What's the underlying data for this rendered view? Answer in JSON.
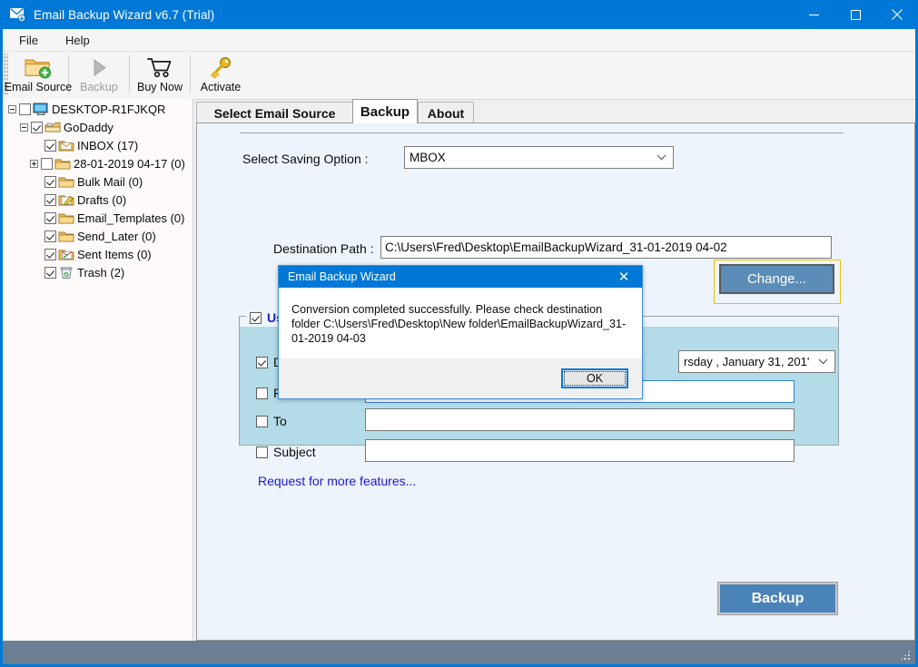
{
  "window": {
    "title": "Email Backup Wizard v6.7 (Trial)",
    "title_icon": "envelope-download-icon",
    "minimize_label": "—",
    "maximize_label": "□",
    "close_label": "✕",
    "accent_color": "#0078d7"
  },
  "menubar": {
    "items": [
      {
        "label": "File"
      },
      {
        "label": "Help"
      }
    ]
  },
  "toolbar": {
    "buttons": [
      {
        "label": "Email Source",
        "icon": "folder-add-icon",
        "disabled": false
      },
      {
        "label": "Backup",
        "icon": "play-triangle-icon",
        "disabled": true
      },
      {
        "label": "Buy Now",
        "icon": "shopping-cart-icon",
        "disabled": false
      },
      {
        "label": "Activate",
        "icon": "key-icon",
        "disabled": false
      }
    ]
  },
  "tree": {
    "nodes": [
      {
        "label": "DESKTOP-R1FJKQR",
        "depth": 0,
        "expander": "minus",
        "checked": false,
        "icon": "computer-icon"
      },
      {
        "label": "GoDaddy",
        "depth": 1,
        "expander": "minus",
        "checked": true,
        "icon": "mailbox-icon"
      },
      {
        "label": "INBOX (17)",
        "depth": 2,
        "expander": "none",
        "checked": true,
        "icon": "inbox-folder-icon"
      },
      {
        "label": "28-01-2019 04-17 (0)",
        "depth": 2,
        "expander": "plus",
        "checked": false,
        "icon": "folder-icon"
      },
      {
        "label": "Bulk Mail (0)",
        "depth": 2,
        "expander": "none",
        "checked": true,
        "icon": "folder-icon"
      },
      {
        "label": "Drafts (0)",
        "depth": 2,
        "expander": "none",
        "checked": true,
        "icon": "drafts-folder-icon"
      },
      {
        "label": "Email_Templates (0)",
        "depth": 2,
        "expander": "none",
        "checked": true,
        "icon": "folder-icon"
      },
      {
        "label": "Send_Later (0)",
        "depth": 2,
        "expander": "none",
        "checked": true,
        "icon": "folder-icon"
      },
      {
        "label": "Sent Items (0)",
        "depth": 2,
        "expander": "none",
        "checked": true,
        "icon": "sent-folder-icon"
      },
      {
        "label": "Trash (2)",
        "depth": 2,
        "expander": "none",
        "checked": true,
        "icon": "trash-icon"
      }
    ]
  },
  "tabs": [
    {
      "label": "Select Email Source",
      "active": false
    },
    {
      "label": "Backup",
      "active": true
    },
    {
      "label": "About",
      "active": false
    }
  ],
  "main": {
    "saving_option_label": "Select Saving Option :",
    "saving_option_value": "MBOX",
    "saving_option_chevron": "chevron-down-icon",
    "destination_label": "Destination Path :",
    "destination_value": "C:\\Users\\Fred\\Desktop\\EmailBackupWizard_31-01-2019 04-02",
    "change_button_label": "Change...",
    "backup_button_label": "Backup",
    "backup_button_color": "#4a83b8"
  },
  "filters": {
    "legend_label": "Use",
    "legend_checked": true,
    "legend_color": "#1a22cc",
    "panel_color": "#b3dce8",
    "rows": [
      {
        "label": "Date",
        "checked": true,
        "value": "rsday ,  January   31, 201'",
        "control": "date-picker"
      },
      {
        "label": "From",
        "checked": false,
        "value": "",
        "control": "textbox"
      },
      {
        "label": "To",
        "checked": false,
        "value": "",
        "control": "textbox"
      },
      {
        "label": "Subject",
        "checked": false,
        "value": "",
        "control": "textbox"
      }
    ],
    "more_features_link": "Request for more features..."
  },
  "dialog": {
    "title": "Email Backup Wizard",
    "close_label": "✕",
    "message": "Conversion completed successfully. Please check destination folder C:\\Users\\Fred\\Desktop\\New folder\\EmailBackupWizard_31-01-2019 04-03",
    "ok_label": "OK"
  },
  "statusbar": {
    "text": "",
    "color": "#6d7f92",
    "grip_icon": "resize-grip-icon"
  }
}
